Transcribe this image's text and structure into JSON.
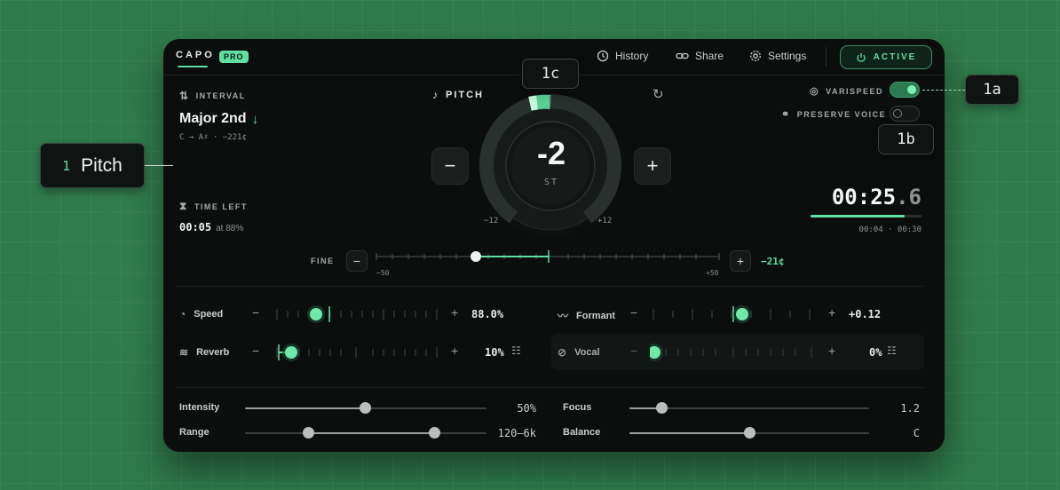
{
  "header": {
    "logo": "CAPO",
    "badge": "PRO",
    "nav": [
      {
        "label": "History",
        "icon": "history-icon"
      },
      {
        "label": "Share",
        "icon": "link-icon"
      },
      {
        "label": "Settings",
        "icon": "gear-icon"
      }
    ],
    "active_label": "ACTIVE"
  },
  "interval": {
    "label": "INTERVAL",
    "name": "Major 2nd",
    "detail": "C → A♯ · −221¢"
  },
  "time_left": {
    "label": "TIME LEFT",
    "value": "00:05",
    "suffix": "at 88%"
  },
  "pitch": {
    "label": "PITCH",
    "value": "-2",
    "unit": "ST",
    "min_label": "−12",
    "max_label": "+12",
    "minus": "−",
    "plus": "+"
  },
  "toggles": {
    "varispeed": {
      "label": "VARISPEED",
      "on": true
    },
    "preserve_voice": {
      "label": "PRESERVE VOICE",
      "on": false
    }
  },
  "timer": {
    "main": "00:25",
    "fraction": ".6",
    "progress": 0.85,
    "range": "00:04 · 00:30"
  },
  "fine": {
    "label": "FINE",
    "min": "−50",
    "max": "+50",
    "value": "−21¢",
    "minus": "−",
    "plus": "+"
  },
  "knobs": [
    {
      "label": "Speed",
      "value": "88.0%",
      "icon": "speed-icon"
    },
    {
      "label": "Formant",
      "value": "+0.12",
      "icon": "waveform-icon"
    },
    {
      "label": "Reverb",
      "value": "10%",
      "icon": "reverb-icon"
    },
    {
      "label": "Vocal",
      "value": "0%",
      "icon": "mute-mic-icon"
    }
  ],
  "sliders": [
    {
      "label": "Intensity",
      "value": "50%"
    },
    {
      "label": "Focus",
      "value": "1.2"
    },
    {
      "label": "Range",
      "value": "120–6k"
    },
    {
      "label": "Balance",
      "value": "C"
    }
  ],
  "callouts": {
    "pitch_num": "1",
    "pitch_label": "Pitch",
    "c1a": "1a",
    "c1b": "1b",
    "c1c": "1c"
  },
  "colors": {
    "accent": "#5fe0a0",
    "background": "#2f7a4a",
    "panel": "#0c0e0e"
  }
}
